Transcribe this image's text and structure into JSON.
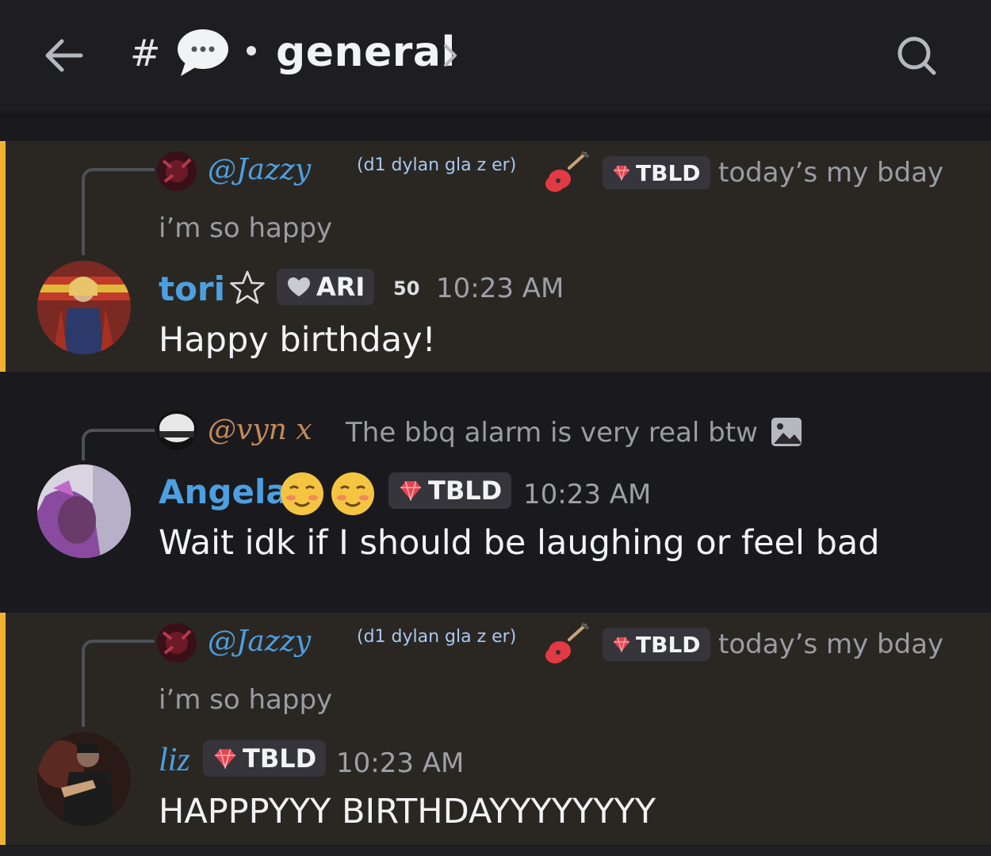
{
  "header": {
    "hash": "#",
    "channel_name": "general",
    "icons": {
      "back": "arrow-left-icon",
      "bubble": "speech-bubble-icon",
      "chevron": "chevron-right-icon",
      "search": "search-icon"
    }
  },
  "messages": [
    {
      "highlighted": true,
      "reply": {
        "mention": "@Jazzy",
        "tag": "(d1 dylan gla z er)",
        "badge": "TBLD",
        "text": "today’s my bday",
        "text2": "i’m so happy"
      },
      "author": "tori",
      "author_color": "#4d9fe0",
      "badge": "ARI",
      "extra": "50",
      "time": "10:23 AM",
      "content": "Happy birthday!"
    },
    {
      "highlighted": false,
      "reply": {
        "mention": "@vyn x",
        "text": "The bbq alarm is very real btw"
      },
      "author": "Angela",
      "author_color": "#4d9fe0",
      "badge": "TBLD",
      "time": "10:23 AM",
      "content": "Wait idk if I should be laughing or feel bad"
    },
    {
      "highlighted": true,
      "reply": {
        "mention": "@Jazzy",
        "tag": "(d1 dylan gla z er)",
        "badge": "TBLD",
        "text": "today’s my bday",
        "text2": "i’m so happy"
      },
      "author": "liz",
      "author_color": "#4d9fe0",
      "badge": "TBLD",
      "time": "10:23 AM",
      "content": "HAPPPYYY BIRTHDAYYYYYYYY"
    }
  ],
  "colors": {
    "accent_bar": "#f0b232",
    "highlight_bg": "#2a2723",
    "background": "#1a1a1e",
    "username": "#4d9fe0",
    "gem": "#e8434f"
  }
}
